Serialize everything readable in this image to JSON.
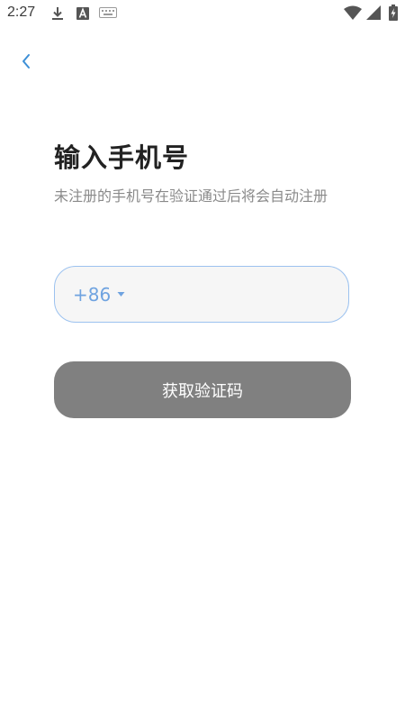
{
  "status_bar": {
    "time": "2:27",
    "icons": [
      "download-icon",
      "accessibility-icon",
      "keyboard-icon",
      "wifi-icon",
      "cell-signal-icon",
      "battery-charging-icon"
    ]
  },
  "header": {
    "back_icon": "chevron-left-icon"
  },
  "main": {
    "title": "输入手机号",
    "subtitle": " 未注册的手机号在验证通过后将会自动注册",
    "phone": {
      "country_code": "+86",
      "value": "",
      "placeholder": ""
    },
    "submit_label": "获取验证码"
  },
  "colors": {
    "accent": "#6fa3e0",
    "field_border": "#9cc2ef",
    "button_disabled": "#808080",
    "title": "#222222",
    "subtitle": "#8a8a8a"
  }
}
